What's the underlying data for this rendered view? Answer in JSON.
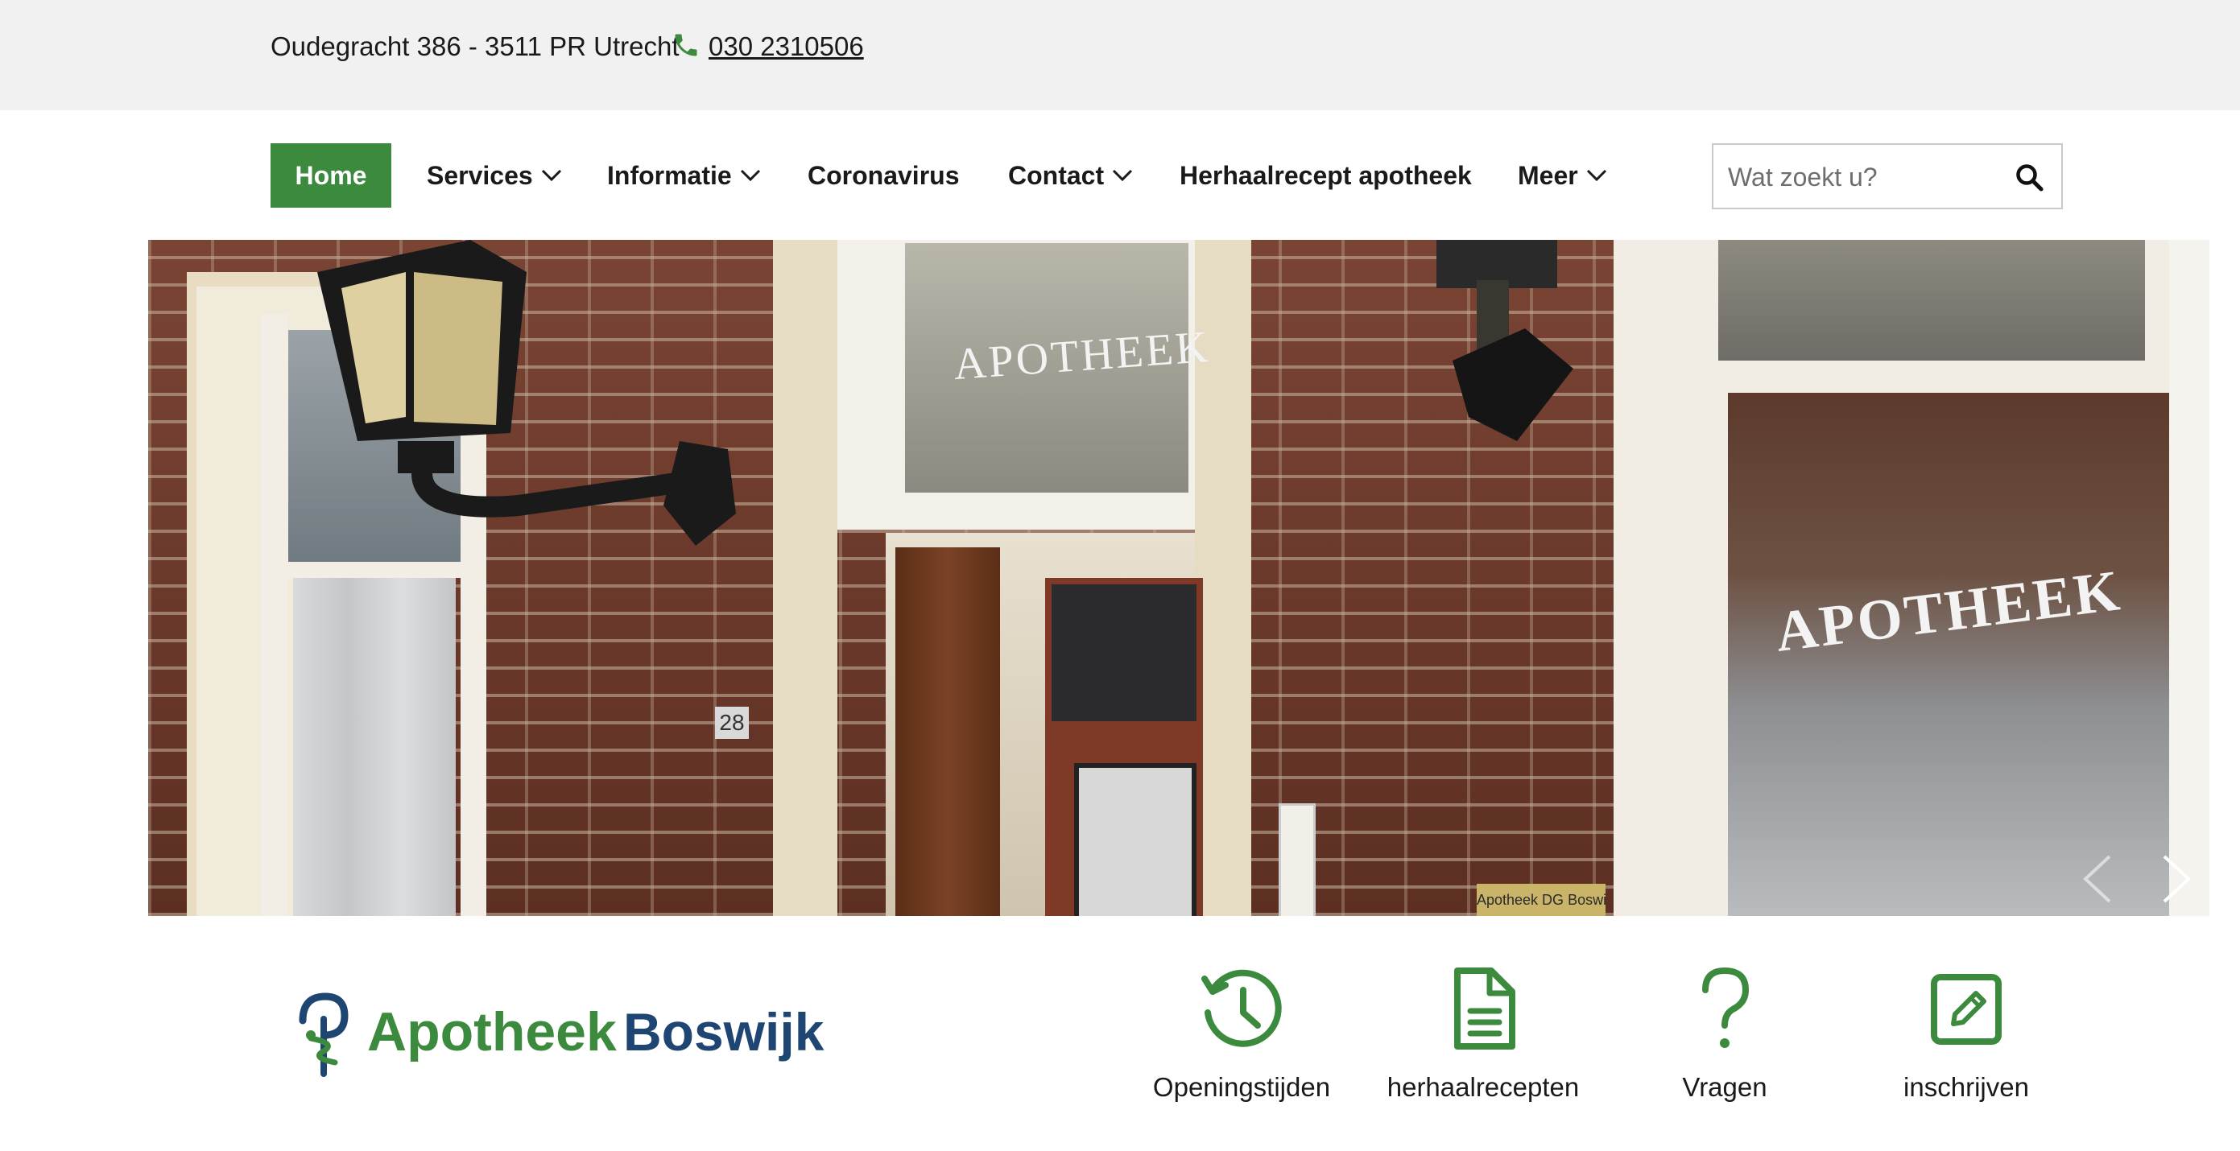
{
  "topbar": {
    "address": "Oudegracht 386 - 3511 PR Utrecht",
    "phone": "030 2310506",
    "phone_icon": "phone-icon"
  },
  "nav": {
    "items": [
      {
        "label": "Home",
        "active": true,
        "has_dropdown": false
      },
      {
        "label": "Services",
        "has_dropdown": true
      },
      {
        "label": "Informatie",
        "has_dropdown": true
      },
      {
        "label": "Coronavirus",
        "has_dropdown": false
      },
      {
        "label": "Contact",
        "has_dropdown": true
      },
      {
        "label": "Herhaalrecept apotheek",
        "has_dropdown": false
      },
      {
        "label": "Meer",
        "has_dropdown": true
      }
    ],
    "search_placeholder": "Wat zoekt u?",
    "search_icon": "search-icon"
  },
  "hero": {
    "sign_top": "APOTHEEK",
    "sign_right": "APOTHEEK",
    "house_number": "28",
    "nameplate": "Apotheek DG Boswijk"
  },
  "logo": {
    "word1": "Apotheek",
    "word2": "Boswijk"
  },
  "quick_links": [
    {
      "label": "Openingstijden",
      "icon": "history-clock-icon"
    },
    {
      "label": "herhaalrecepten",
      "icon": "document-icon"
    },
    {
      "label": "Vragen",
      "icon": "question-mark-icon"
    },
    {
      "label": "inschrijven",
      "icon": "edit-icon"
    }
  ],
  "colors": {
    "brand_green": "#3c8a3e",
    "brand_blue": "#1f4672",
    "topbar_bg": "#f1f1f1"
  }
}
